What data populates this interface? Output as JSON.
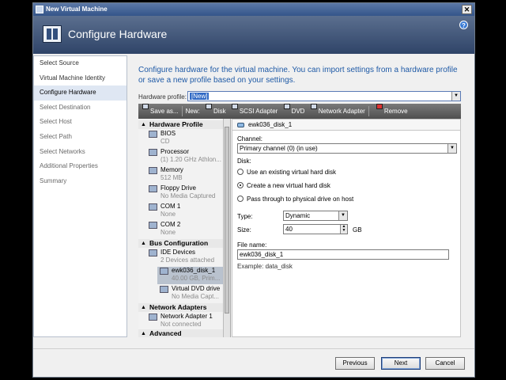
{
  "window": {
    "title": "New Virtual Machine"
  },
  "banner": {
    "title": "Configure Hardware"
  },
  "steps": [
    "Select Source",
    "Virtual Machine Identity",
    "Configure Hardware",
    "Select Destination",
    "Select Host",
    "Select Path",
    "Select Networks",
    "Additional Properties",
    "Summary"
  ],
  "intro": "Configure hardware for the virtual machine. You can import settings from a hardware profile or save a new profile based on your settings.",
  "profile": {
    "label": "Hardware profile:",
    "value": "[New]"
  },
  "toolbar": {
    "save_as": "Save as...",
    "new": "New:",
    "disk": "Disk",
    "scsi": "SCSI Adapter",
    "dvd": "DVD",
    "network": "Network Adapter",
    "remove": "Remove"
  },
  "tree": {
    "hardware_profile": "Hardware Profile",
    "bios": {
      "name": "BIOS",
      "sub": "CD"
    },
    "processor": {
      "name": "Processor",
      "sub": "(1) 1.20 GHz Athlon..."
    },
    "memory": {
      "name": "Memory",
      "sub": "512 MB"
    },
    "floppy": {
      "name": "Floppy Drive",
      "sub": "No Media Captured"
    },
    "com1": {
      "name": "COM 1",
      "sub": "None"
    },
    "com2": {
      "name": "COM 2",
      "sub": "None"
    },
    "bus_configuration": "Bus Configuration",
    "ide": {
      "name": "IDE Devices",
      "sub": "2 Devices attached"
    },
    "disk": {
      "name": "ewk036_disk_1",
      "sub": "40.00 GB, Prim..."
    },
    "dvd": {
      "name": "Virtual DVD drive",
      "sub": "No Media Capt..."
    },
    "network_adapters": "Network Adapters",
    "nic1": {
      "name": "Network Adapter 1",
      "sub": "Not connected"
    },
    "advanced": "Advanced"
  },
  "detail": {
    "header": "ewk036_disk_1",
    "channel_label": "Channel:",
    "channel_value": "Primary channel (0) (in use)",
    "disk_label": "Disk:",
    "opt_existing": "Use an existing virtual hard disk",
    "opt_create": "Create a new virtual hard disk",
    "opt_passthrough": "Pass through to physical drive on host",
    "type_label": "Type:",
    "type_value": "Dynamic",
    "size_label": "Size:",
    "size_value": "40",
    "size_unit": "GB",
    "filename_label": "File name:",
    "filename_value": "ewk036_disk_1",
    "example": "Example: data_disk"
  },
  "buttons": {
    "previous": "Previous",
    "next": "Next",
    "cancel": "Cancel"
  }
}
